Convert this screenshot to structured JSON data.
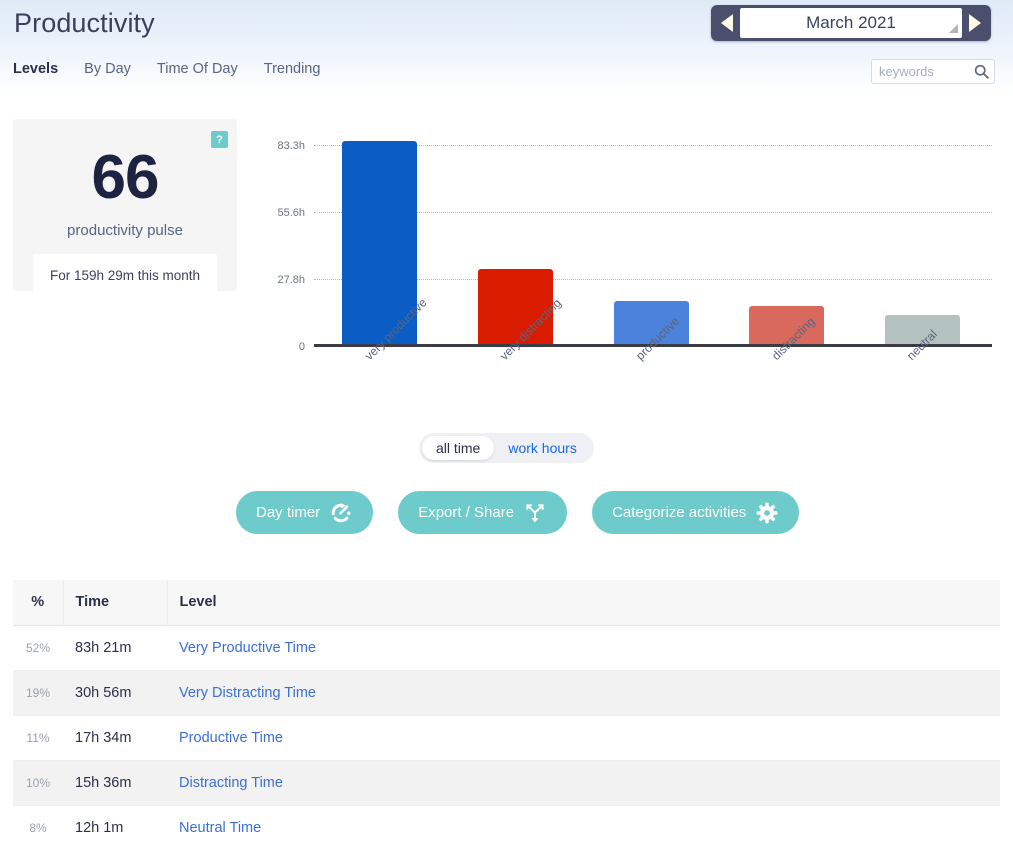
{
  "header": {
    "title": "Productivity",
    "tabs": [
      {
        "label": "Levels",
        "active": true
      },
      {
        "label": "By Day",
        "active": false
      },
      {
        "label": "Time Of Day",
        "active": false
      },
      {
        "label": "Trending",
        "active": false
      }
    ],
    "datepicker": {
      "value": "March 2021",
      "prev_icon": "left-triangle-icon",
      "next_icon": "right-triangle-icon"
    },
    "search": {
      "placeholder": "keywords",
      "value": "",
      "icon": "search-icon"
    }
  },
  "pulse": {
    "score": "66",
    "label": "productivity pulse",
    "summary": "For 159h 29m this month",
    "help_badge": "?",
    "badge_color": "#6ecbcb"
  },
  "chart_data": {
    "type": "bar",
    "title": "",
    "xlabel": "",
    "ylabel": "",
    "categories": [
      "very productive",
      "very distracting",
      "productive",
      "distracting",
      "neutral"
    ],
    "values": [
      83.35,
      30.93,
      17.57,
      15.6,
      12.02
    ],
    "value_labels": [
      "83h 21m",
      "30h 56m",
      "17h 34m",
      "15h 36m",
      "12h 1m"
    ],
    "colors": [
      "#0b5cc4",
      "#d91c00",
      "#4b82db",
      "#d9695c",
      "#b3c2bf"
    ],
    "ytick_labels": [
      "0",
      "27.8h",
      "55.6h",
      "83.3h"
    ],
    "ytick_values": [
      0,
      27.8,
      55.6,
      83.3
    ],
    "ylim": [
      0,
      86
    ],
    "grid": true,
    "legend": "none"
  },
  "toggle": {
    "options": [
      {
        "label": "all time",
        "active": true
      },
      {
        "label": "work hours",
        "active": false
      }
    ]
  },
  "actions": [
    {
      "label": "Day timer",
      "icon": "timer-icon"
    },
    {
      "label": "Export / Share",
      "icon": "share-icon"
    },
    {
      "label": "Categorize activities",
      "icon": "gear-icon"
    }
  ],
  "table": {
    "columns": [
      "%",
      "Time",
      "Level"
    ],
    "rows": [
      {
        "pct": "52%",
        "time": "83h 21m",
        "level": "Very Productive Time"
      },
      {
        "pct": "19%",
        "time": "30h 56m",
        "level": "Very Distracting Time"
      },
      {
        "pct": "11%",
        "time": "17h 34m",
        "level": "Productive Time"
      },
      {
        "pct": "10%",
        "time": "15h 36m",
        "level": "Distracting Time"
      },
      {
        "pct": "8%",
        "time": "12h 1m",
        "level": "Neutral Time"
      }
    ]
  }
}
